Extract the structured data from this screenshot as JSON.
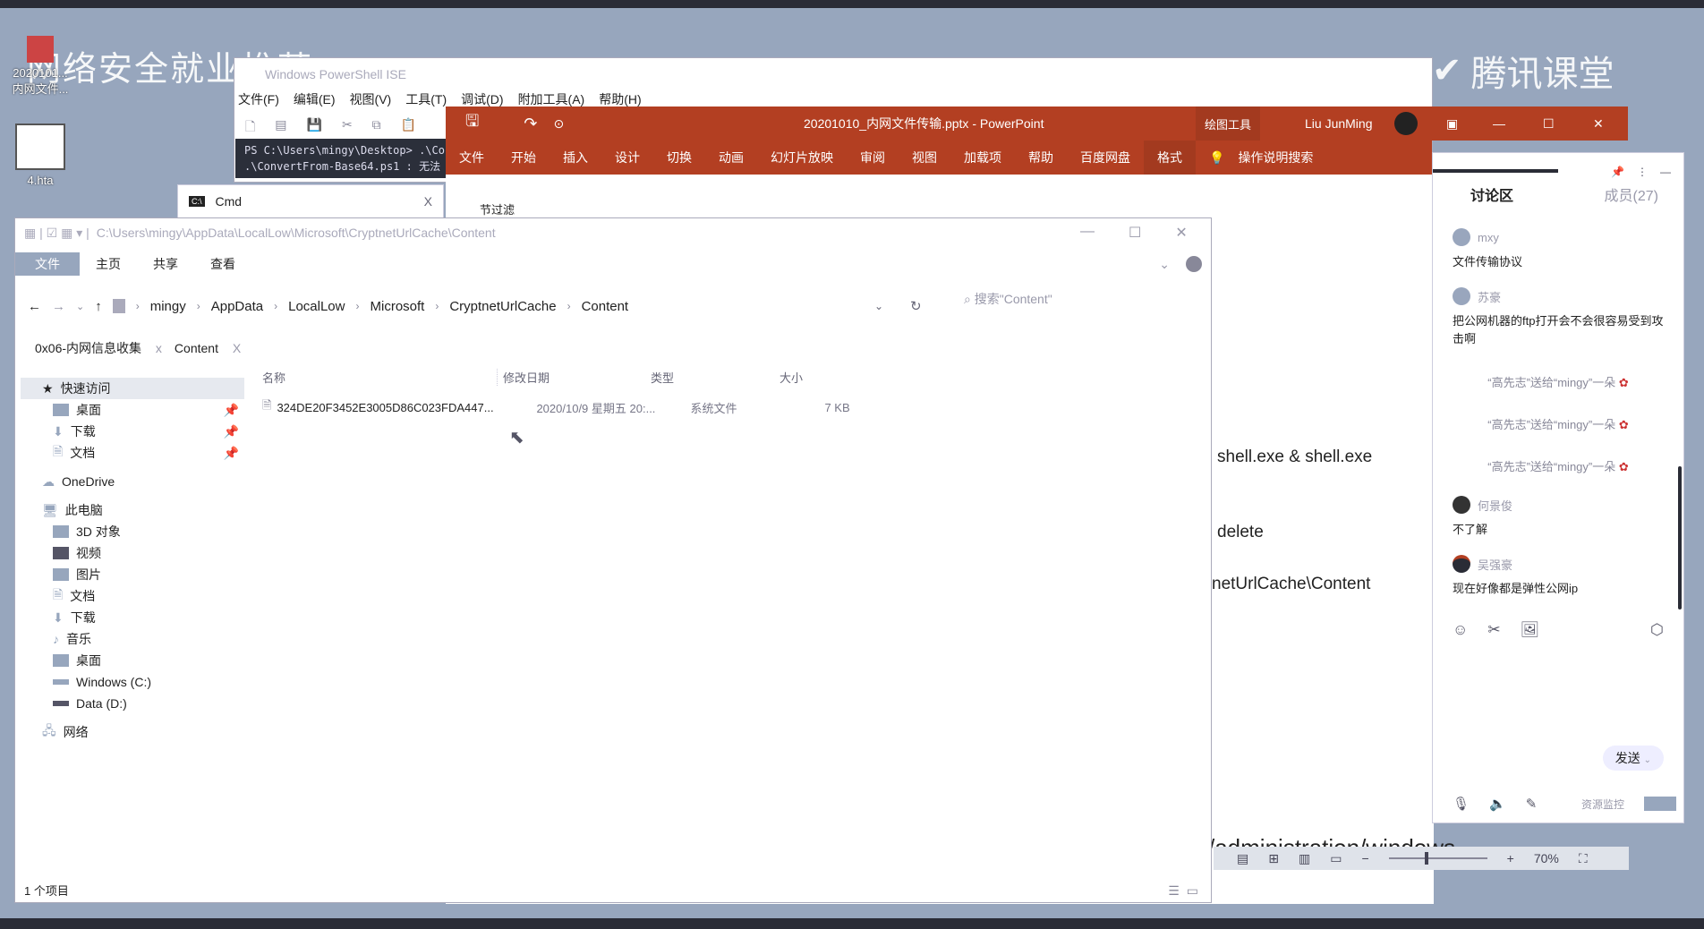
{
  "desktop": {
    "watermark": "网络安全就业推荐",
    "logo": "腾讯课堂",
    "icons": [
      {
        "label": "2020101...\n内网文件..."
      },
      {
        "label": "4.hta"
      }
    ]
  },
  "powershell": {
    "title": "Windows PowerShell ISE",
    "menu": [
      "文件(F)",
      "编辑(E)",
      "视图(V)",
      "工具(T)",
      "调试(D)",
      "附加工具(A)",
      "帮助(H)"
    ],
    "console": [
      "PS C:\\Users\\mingy\\Desktop> .\\Co",
      "  .\\ConvertFrom-Base64.ps1 : 无法"
    ]
  },
  "cmd": {
    "label": "Cmd",
    "close": "X"
  },
  "powerpoint": {
    "title": "20201010_内网文件传输.pptx  -  PowerPoint",
    "contextual": "绘图工具",
    "user": "Liu JunMing",
    "tabs": [
      "文件",
      "开始",
      "插入",
      "设计",
      "切换",
      "动画",
      "幻灯片放映",
      "审阅",
      "视图",
      "加载项",
      "帮助",
      "百度网盘"
    ],
    "format_tab": "格式",
    "search": "操作说明搜索",
    "section": "节过滤",
    "slide_lines": [
      "shell.exe & shell.exe",
      "delete",
      "netUrlCache\\Content",
      "/administration/windows"
    ],
    "zoom": "70%"
  },
  "chat": {
    "tab": "讨论区",
    "members": "成员(27)",
    "messages": [
      {
        "user": "mxy",
        "text": "文件传输协议"
      },
      {
        "user": "苏豪",
        "text": "把公网机器的ftp打开会不会很容易受到攻击啊"
      }
    ],
    "gifts": [
      "“高先志”送给“mingy”一朵",
      "“高先志”送给“mingy”一朵",
      "“高先志”送给“mingy”一朵"
    ],
    "messages2": [
      {
        "user": "何景俊",
        "text": "不了解"
      },
      {
        "user": "吴强豪",
        "text": "现在好像都是弹性公网ip"
      }
    ],
    "send": "发送",
    "monitor": "资源监控"
  },
  "explorer": {
    "path": "C:\\Users\\mingy\\AppData\\LocalLow\\Microsoft\\CryptnetUrlCache\\Content",
    "ribbon": [
      "文件",
      "主页",
      "共享",
      "查看"
    ],
    "breadcrumb": [
      "mingy",
      "AppData",
      "LocalLow",
      "Microsoft",
      "CryptnetUrlCache",
      "Content"
    ],
    "search_placeholder": "搜索\"Content\"",
    "tabs": [
      "0x06-内网信息收集",
      "Content"
    ],
    "nav": {
      "quick": "快速访问",
      "quick_items": [
        "桌面",
        "下载",
        "文档"
      ],
      "onedrive": "OneDrive",
      "pc": "此电脑",
      "pc_items": [
        "3D 对象",
        "视频",
        "图片",
        "文档",
        "下载",
        "音乐",
        "桌面",
        "Windows (C:)",
        "Data (D:)"
      ],
      "network": "网络"
    },
    "columns": [
      "名称",
      "修改日期",
      "类型",
      "大小"
    ],
    "files": [
      {
        "name": "324DE20F3452E3005D86C023FDA447...",
        "date": "2020/10/9 星期五 20:...",
        "type": "系统文件",
        "size": "7 KB"
      }
    ],
    "status": "1 个项目"
  }
}
